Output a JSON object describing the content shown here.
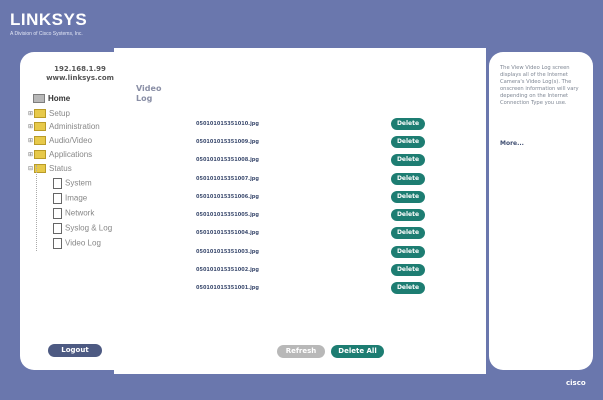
{
  "header": {
    "brand": "LINKSYS",
    "tagline": "A Division of Cisco Systems, Inc."
  },
  "device": {
    "ip": "192.168.1.99",
    "site": "www.linksys.com"
  },
  "nav": {
    "home": "Home",
    "setup": "Setup",
    "administration": "Administration",
    "audio_video": "Audio/Video",
    "applications": "Applications",
    "status": "Status",
    "status_items": [
      "System",
      "Image",
      "Network",
      "Syslog & Log",
      "Video Log"
    ]
  },
  "page": {
    "title": "Video Log"
  },
  "files": [
    "050101015351010.jpg",
    "050101015351009.jpg",
    "050101015351008.jpg",
    "050101015351007.jpg",
    "050101015351006.jpg",
    "050101015351005.jpg",
    "050101015351004.jpg",
    "050101015351003.jpg",
    "050101015351002.jpg",
    "050101015351001.jpg"
  ],
  "buttons": {
    "delete": "Delete",
    "refresh": "Refresh",
    "delete_all": "Delete All",
    "logout": "Logout"
  },
  "help": {
    "text": "The View Video Log screen displays all of the Internet Camera's Video Log(s). The onscreen information will vary depending on the Internet Connection Type you use.",
    "more": "More..."
  },
  "footer": {
    "logo": "cisco"
  },
  "colors": {
    "frame": "#6a77ad",
    "button_teal": "#1d7d72"
  }
}
